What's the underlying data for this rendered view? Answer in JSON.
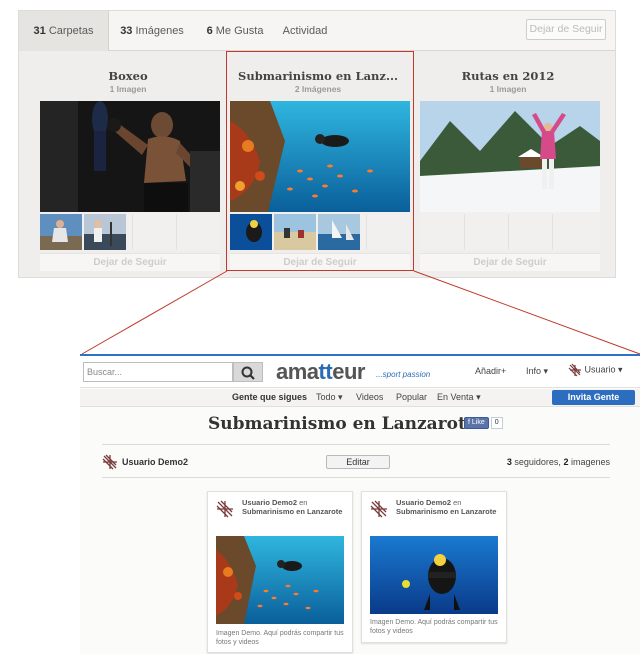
{
  "top": {
    "tabs": [
      {
        "count": "31",
        "label": "Carpetas",
        "active": true
      },
      {
        "count": "33",
        "label": "Imágenes",
        "active": false
      },
      {
        "count": "6",
        "label": "Me Gusta",
        "active": false
      },
      {
        "count": "",
        "label": "Actividad",
        "active": false
      }
    ],
    "unfollow_label": "Dejar de Seguir",
    "boards": [
      {
        "title": "Boxeo",
        "count": "1 Imagen",
        "follow": "Dejar de Seguir"
      },
      {
        "title": "Submarinismo en Lanz...",
        "count": "2 Imágenes",
        "follow": "Dejar de Seguir"
      },
      {
        "title": "Rutas en 2012",
        "count": "1 Imagen",
        "follow": "Dejar de Seguir"
      }
    ]
  },
  "bottom": {
    "search_placeholder": "Buscar...",
    "logo_prefix": "ama",
    "logo_accent": "tt",
    "logo_suffix": "eur",
    "logo_tagline": "...sport passion",
    "nav": {
      "add": "Añadir+",
      "info": "Info",
      "user": "Usuario"
    },
    "subnav": {
      "following": "Gente que sigues",
      "all": "Todo",
      "videos": "Videos",
      "popular": "Popular",
      "sale": "En Venta"
    },
    "invite": "Invita Gente",
    "title": "Submarinismo en Lanzarote",
    "like_label": "Like",
    "like_count": "0",
    "owner": "Usuario Demo2",
    "edit": "Editar",
    "followers_count": "3",
    "followers_label": "seguidores,",
    "images_count": "2",
    "images_label": "imagenes",
    "pins": [
      {
        "user": "Usuario Demo2",
        "connector": "en",
        "board": "Submarinismo en Lanzarote",
        "caption": "Imagen Demo. Aquí podrás compartir tus fotos y videos"
      },
      {
        "user": "Usuario Demo2",
        "connector": "en",
        "board": "Submarinismo en Lanzarote",
        "caption": "Imagen Demo. Aquí podrás compartir tus fotos y videos"
      }
    ]
  },
  "colors": {
    "accent_blue": "#2d6dc0",
    "highlight_red": "#c0392b"
  }
}
